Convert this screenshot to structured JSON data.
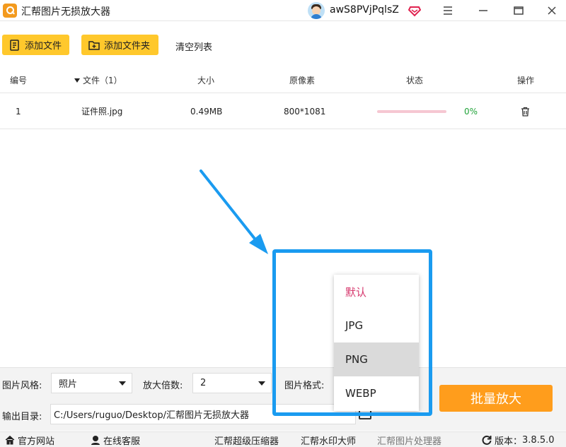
{
  "app": {
    "title": "汇帮图片无损放大器",
    "username": "awS8PVjPqlsZ",
    "accent": "#ffc82c",
    "action_color": "#ff9d1c",
    "highlight_color": "#1a9bf0"
  },
  "window_controls": [
    "menu-icon",
    "minimize-icon",
    "maximize-icon",
    "close-icon"
  ],
  "toolbar": {
    "add_file": "添加文件",
    "add_folder": "添加文件夹",
    "clear_list": "清空列表"
  },
  "table": {
    "headers": {
      "index": "编号",
      "file": "文件（1）",
      "size": "大小",
      "pixels": "原像素",
      "status": "状态",
      "action": "操作"
    },
    "rows": [
      {
        "index": "1",
        "file": "证件照.jpg",
        "size": "0.49MB",
        "pixels": "800*1081",
        "progress": 0,
        "status_text": "0%"
      }
    ]
  },
  "settings": {
    "style_label": "图片风格:",
    "style_value": "照片",
    "scale_label": "放大倍数:",
    "scale_value": "2",
    "format_label": "图片格式:",
    "output_label": "输出目录:",
    "output_path": "C:/Users/ruguo/Desktop/汇帮图片无损放大器",
    "start_button": "批量放大"
  },
  "format_dropdown": {
    "options": [
      "默认",
      "JPG",
      "PNG",
      "WEBP"
    ],
    "selected_index": 0,
    "hover_index": 2
  },
  "statusbar": {
    "website": "官方网站",
    "support": "在线客服",
    "compressor": "汇帮超级压缩器",
    "watermark": "汇帮水印大师",
    "image_processor": "汇帮图片处理器",
    "version_label": "版本：",
    "version": "3.8.5.0"
  }
}
